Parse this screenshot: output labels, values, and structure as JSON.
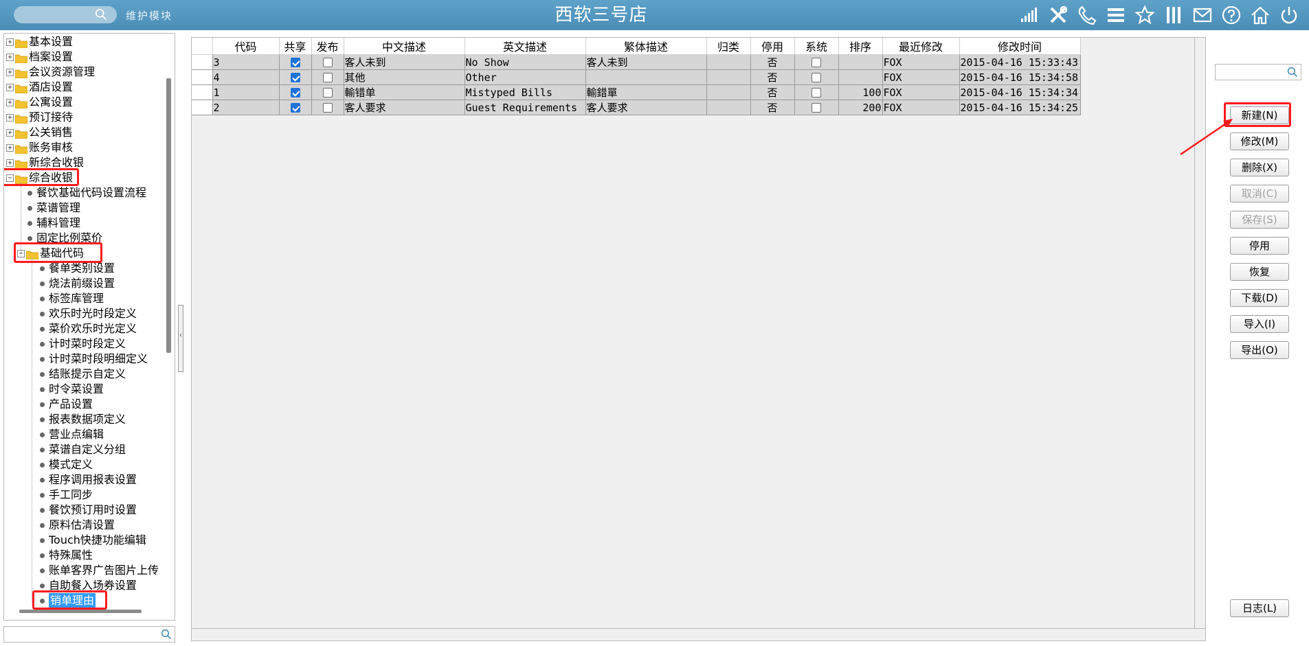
{
  "header": {
    "module_label": "维护模块",
    "title": "西软三号店",
    "icons": [
      "signal-icon",
      "tools-icon",
      "phone-icon",
      "menu-icon",
      "star-icon",
      "columns-icon",
      "mail-icon",
      "help-icon",
      "home-icon",
      "power-icon"
    ]
  },
  "tree": {
    "top_items": [
      "基本设置",
      "档案设置",
      "会议资源管理",
      "酒店设置",
      "公寓设置",
      "预订接待",
      "公关销售",
      "账务审核",
      "新综合收银"
    ],
    "expanded_item": "综合收银",
    "children": [
      "餐饮基础代码设置流程",
      "菜谱管理",
      "辅料管理",
      "固定比例菜价"
    ],
    "sub_folder": "基础代码",
    "sub_children": [
      "餐单类别设置",
      "烧法前缀设置",
      "标签库管理",
      "欢乐时光时段定义",
      "菜价欢乐时光定义",
      "计时菜时段定义",
      "计时菜时段明细定义",
      "结账提示自定义",
      "时令菜设置",
      "产品设置",
      "报表数据项定义",
      "营业点编辑",
      "菜谱自定义分组",
      "模式定义",
      "程序调用报表设置",
      "手工同步",
      "餐饮预订用时设置",
      "原料估清设置",
      "Touch快捷功能编辑",
      "特殊属性",
      "账单客界广告图片上传",
      "自助餐入场券设置"
    ],
    "selected_item": "销单理由"
  },
  "grid": {
    "columns": [
      "代码",
      "共享",
      "发布",
      "中文描述",
      "英文描述",
      "繁体描述",
      "归类",
      "停用",
      "系统",
      "排序",
      "最近修改",
      "修改时间"
    ],
    "rows": [
      {
        "code": "3",
        "shared": true,
        "publish": false,
        "cn": "客人未到",
        "en": "No Show",
        "tw": "客人未到",
        "category": "",
        "disabled": "否",
        "system": false,
        "sort": "",
        "modifier": "FOX",
        "time": "2015-04-16 15:33:43"
      },
      {
        "code": "4",
        "shared": true,
        "publish": false,
        "cn": "其他",
        "en": "Other",
        "tw": "",
        "category": "",
        "disabled": "否",
        "system": false,
        "sort": "",
        "modifier": "FOX",
        "time": "2015-04-16 15:34:58"
      },
      {
        "code": "1",
        "shared": true,
        "publish": false,
        "cn": "輸错单",
        "en": "Mistyped Bills",
        "tw": "輸錯單",
        "category": "",
        "disabled": "否",
        "system": false,
        "sort": "100",
        "modifier": "FOX",
        "time": "2015-04-16 15:34:34"
      },
      {
        "code": "2",
        "shared": true,
        "publish": false,
        "cn": "客人要求",
        "en": "Guest Requirements",
        "tw": "客人要求",
        "category": "",
        "disabled": "否",
        "system": false,
        "sort": "200",
        "modifier": "FOX",
        "time": "2015-04-16 15:34:25"
      }
    ]
  },
  "buttons": {
    "new": "新建(N)",
    "modify": "修改(M)",
    "delete": "删除(X)",
    "cancel": "取消(C)",
    "save": "保存(S)",
    "disable": "停用",
    "restore": "恢复",
    "download": "下载(D)",
    "import": "导入(I)",
    "export": "导出(O)",
    "log": "日志(L)"
  },
  "colors": {
    "header_bg": "#4f93be",
    "annotation_red": "#ff1a1a",
    "selection_blue": "#3399ff",
    "checkbox_blue": "#1e73d8"
  }
}
